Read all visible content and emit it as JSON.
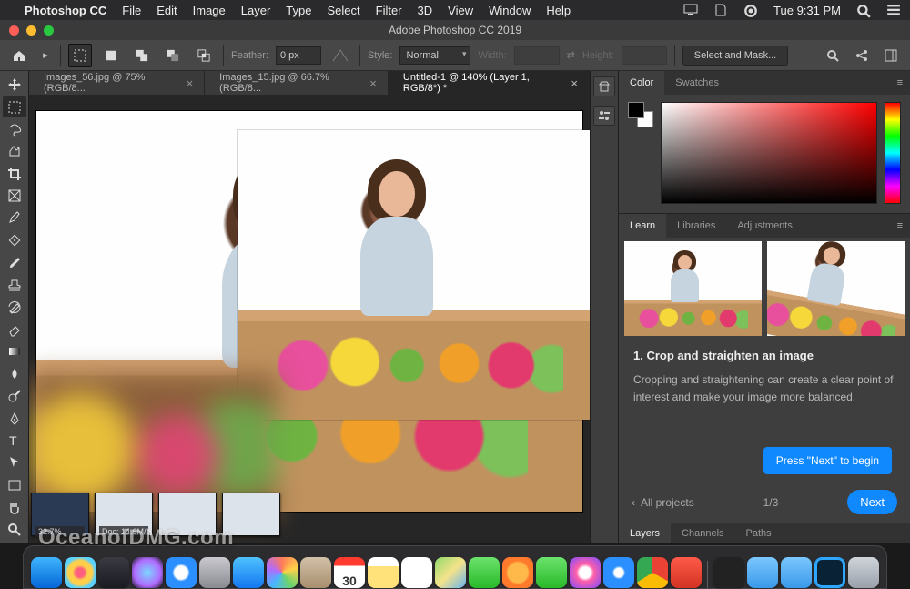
{
  "mac_menu": {
    "app": "Photoshop CC",
    "items": [
      "File",
      "Edit",
      "Image",
      "Layer",
      "Type",
      "Select",
      "Filter",
      "3D",
      "View",
      "Window",
      "Help"
    ],
    "clock": "Tue 9:31 PM"
  },
  "window": {
    "title": "Adobe Photoshop CC 2019"
  },
  "options_bar": {
    "feather_label": "Feather:",
    "feather_value": "0 px",
    "style_label": "Style:",
    "style_value": "Normal",
    "width_label": "Width:",
    "height_label": "Height:",
    "select_mask": "Select and Mask..."
  },
  "doc_tabs": [
    "Images_56.jpg @ 75% (RGB/8...",
    "Images_15.jpg @ 66.7% (RGB/8...",
    "Untitled-1 @ 140% (Layer 1, RGB/8*) *"
  ],
  "doc_tabs_active": 2,
  "color_panel": {
    "tabs": [
      "Color",
      "Swatches"
    ],
    "active": 0
  },
  "learn_panel": {
    "tabs": [
      "Learn",
      "Libraries",
      "Adjustments"
    ],
    "active": 0,
    "heading": "1.  Crop and straighten an image",
    "body": "Cropping and straightening can create a clear point of interest and make your image more balanced.",
    "back_label": "All projects",
    "count": "1/3",
    "next_label": "Next",
    "tooltip": "Press \"Next\" to begin"
  },
  "layers_tabs": [
    "Layers",
    "Channels",
    "Paths"
  ],
  "dock": {
    "apps": [
      {
        "name": "finder",
        "bg": "linear-gradient(180deg,#3fb5ff,#0566d6)"
      },
      {
        "name": "launchpad",
        "bg": "radial-gradient(circle,#ff5f7e 0 20%,#ffcf4b 35% 55%,#5ad1ff 70% 100%)"
      },
      {
        "name": "mission-control",
        "bg": "linear-gradient(180deg,#3a3a42,#1a1b22)"
      },
      {
        "name": "siri",
        "bg": "radial-gradient(circle at 50% 50%,#7ad7ff,#b06bff 60%,#111 100%)"
      },
      {
        "name": "safari",
        "bg": "radial-gradient(circle,#fefefe 0 30%,#2b8fff 40% 100%)"
      },
      {
        "name": "settings",
        "bg": "linear-gradient(180deg,#c9c9cf,#8a8a92)"
      },
      {
        "name": "mail",
        "bg": "linear-gradient(180deg,#4ec2ff,#1477ef)"
      },
      {
        "name": "photos",
        "bg": "conic-gradient(#ff7a59,#ffd24a,#6bd46b,#4ab6ff,#b06bff,#ff7a59)"
      },
      {
        "name": "contacts",
        "bg": "linear-gradient(180deg,#d2c0a8,#a88f6e)"
      },
      {
        "name": "calendar",
        "bg": "linear-gradient(180deg,#fff 30%,#fff 30%),linear-gradient(180deg,#ff3b30,#ff3b30)",
        "text": "30"
      },
      {
        "name": "notes",
        "bg": "linear-gradient(180deg,#fff 30%,#ffe27a 30%)"
      },
      {
        "name": "reminders",
        "bg": "#fff"
      },
      {
        "name": "maps",
        "bg": "linear-gradient(135deg,#8fd86b,#f4e38a 50%,#68b3f0)"
      },
      {
        "name": "messages",
        "bg": "linear-gradient(180deg,#6be36b,#29b929)"
      },
      {
        "name": "firefox",
        "bg": "radial-gradient(circle,#ffb84a 0 45%,#ff7a2a 55% 80%,#6a35b0 100%)"
      },
      {
        "name": "facetime",
        "bg": "linear-gradient(180deg,#6be36b,#29b929)"
      },
      {
        "name": "itunes",
        "bg": "radial-gradient(circle,#fff 0 25%,#ff5fa8 40%,#7a4bff 100%)"
      },
      {
        "name": "appstore",
        "bg": "radial-gradient(circle,#fff 0 20%,#2b8fff 30% 100%)"
      },
      {
        "name": "chrome",
        "bg": "conic-gradient(#ea4335 0 33%,#fbbc05 33% 66%,#34a853 66% 100%)"
      },
      {
        "name": "magnet",
        "bg": "linear-gradient(180deg,#ff5a4a,#d23322)"
      },
      {
        "name": "sep"
      },
      {
        "name": "terminal",
        "bg": "#222"
      },
      {
        "name": "folder1",
        "bg": "linear-gradient(180deg,#7ac7ff,#3a99e8)"
      },
      {
        "name": "folder2",
        "bg": "linear-gradient(180deg,#7ac7ff,#3a99e8)"
      },
      {
        "name": "photoshop",
        "bg": "linear-gradient(180deg,#0a2236,#0a2236)",
        "ring": "#2da7ff"
      },
      {
        "name": "trash",
        "bg": "linear-gradient(180deg,#cfd4da,#9aa1ab)"
      }
    ]
  },
  "desktop_thumbs": {
    "label1": "32.7%",
    "label2": "Doc: 14.6M/14.0M"
  },
  "watermark": "OceanofDMG.com"
}
